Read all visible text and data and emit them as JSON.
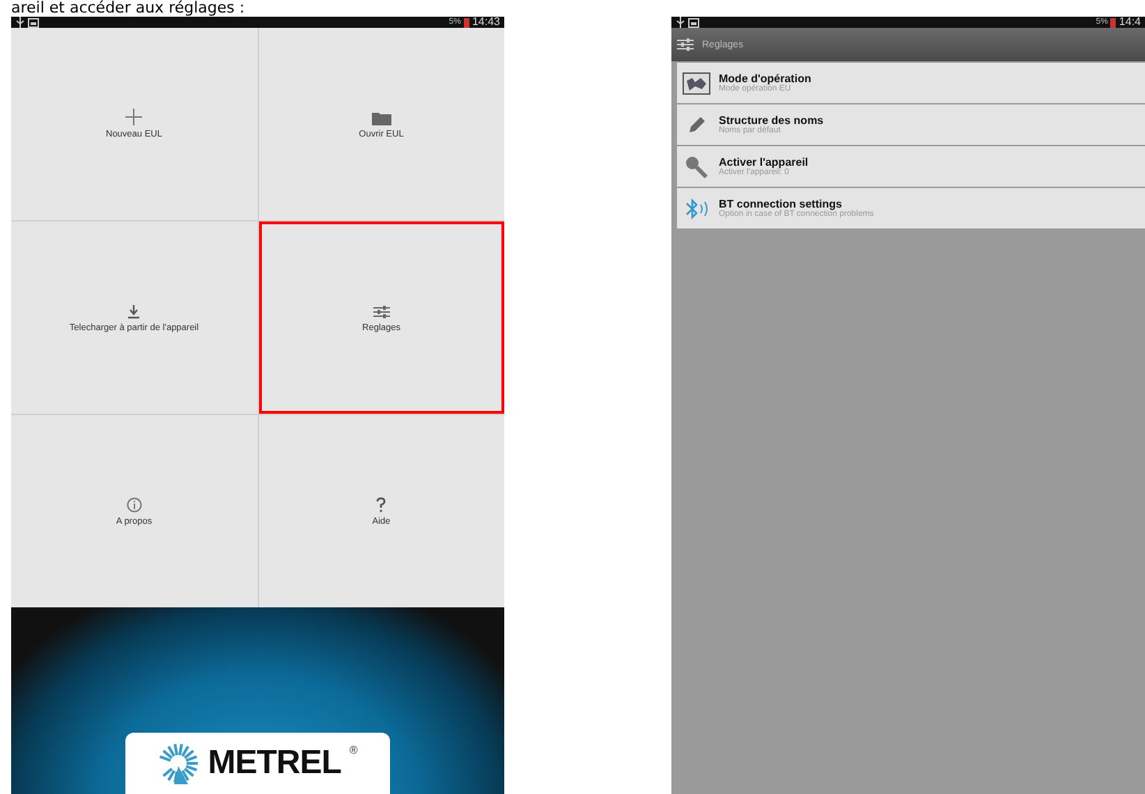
{
  "caption": "areil et accéder aux réglages :",
  "home_screen": {
    "status_bar": {
      "battery": "5%",
      "time": "14:43"
    },
    "tiles": [
      {
        "kind": "plus",
        "label": "Nouveau EUL",
        "highlighted": false
      },
      {
        "kind": "folder",
        "label": "Ouvrir EUL",
        "highlighted": false
      },
      {
        "kind": "download",
        "label": "Telecharger à partir de l'appareil",
        "highlighted": false
      },
      {
        "kind": "sliders",
        "label": "Reglages",
        "highlighted": true
      },
      {
        "kind": "info",
        "label": "A propos",
        "highlighted": false
      },
      {
        "kind": "question",
        "label": "Aide",
        "highlighted": false
      }
    ],
    "logo": {
      "text": "METREL",
      "mark": "®"
    }
  },
  "settings_screen": {
    "status_bar": {
      "battery": "5%",
      "time": "14:4"
    },
    "title": "Reglages",
    "items": [
      {
        "kind": "map",
        "title": "Mode d'opération",
        "subtitle": "Mode opération EU"
      },
      {
        "kind": "pencil",
        "title": "Structure des noms",
        "subtitle": "Noms par défaut"
      },
      {
        "kind": "key",
        "title": "Activer l'appareil",
        "subtitle": "Activer l'appareil: 0"
      },
      {
        "kind": "bluetooth",
        "title": "BT connection settings",
        "subtitle": "Option in case of BT connection problems"
      }
    ]
  }
}
